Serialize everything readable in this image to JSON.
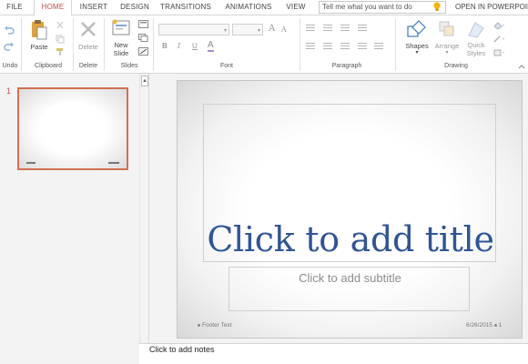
{
  "tabs": [
    {
      "label": "FILE"
    },
    {
      "label": "HOME"
    },
    {
      "label": "INSERT"
    },
    {
      "label": "DESIGN"
    },
    {
      "label": "TRANSITIONS"
    },
    {
      "label": "ANIMATIONS"
    },
    {
      "label": "VIEW"
    }
  ],
  "tell_me": {
    "placeholder": "Tell me what you want to do"
  },
  "open_in": "OPEN IN POWERPOINT",
  "ribbon": {
    "undo": {
      "group": "Undo"
    },
    "clipboard": {
      "paste": "Paste",
      "group": "Clipboard"
    },
    "delete": {
      "label": "Delete",
      "group": "Delete"
    },
    "slides": {
      "new_slide_line1": "New",
      "new_slide_line2": "Slide",
      "group": "Slides"
    },
    "font": {
      "group": "Font",
      "bold": "B",
      "italic": "I",
      "underline": "U",
      "font_color": "A",
      "grow": "A",
      "shrink": "A"
    },
    "paragraph": {
      "group": "Paragraph"
    },
    "drawing": {
      "group": "Drawing",
      "shapes": "Shapes",
      "arrange": "Arrange",
      "quick_line1": "Quick",
      "quick_line2": "Styles"
    }
  },
  "slide_panel": {
    "number": "1"
  },
  "slide": {
    "title_placeholder": "Click to add title",
    "subtitle_placeholder": "Click to add subtitle",
    "footer_text": "Footer Text",
    "date": "6/26/2015",
    "slide_number": "1"
  },
  "notes": {
    "placeholder": "Click to add notes"
  },
  "colors": {
    "accent": "#c0504d",
    "title": "#2f5597",
    "thumb_border": "#d2704f"
  }
}
